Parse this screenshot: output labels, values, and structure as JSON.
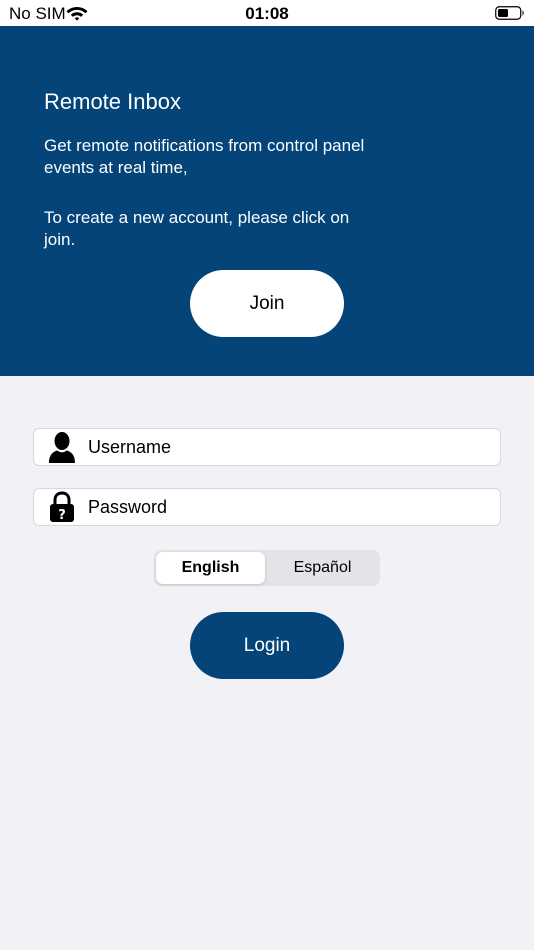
{
  "status_bar": {
    "carrier": "No SIM",
    "time": "01:08"
  },
  "header": {
    "title": "Remote Inbox",
    "paragraph1": "Get remote notifications from control panel events at real time,",
    "paragraph2": "To create a new account, please click on join.",
    "join_label": "Join",
    "background_color": "#044479"
  },
  "form": {
    "username_placeholder": "Username",
    "password_placeholder": "Password",
    "username_icon": "user-silhouette-icon",
    "password_icon": "padlock-question-icon"
  },
  "language": {
    "options": [
      "English",
      "Español"
    ],
    "selected": "English"
  },
  "login_label": "Login",
  "colors": {
    "accent": "#044479",
    "background": "#f2f1f6"
  }
}
